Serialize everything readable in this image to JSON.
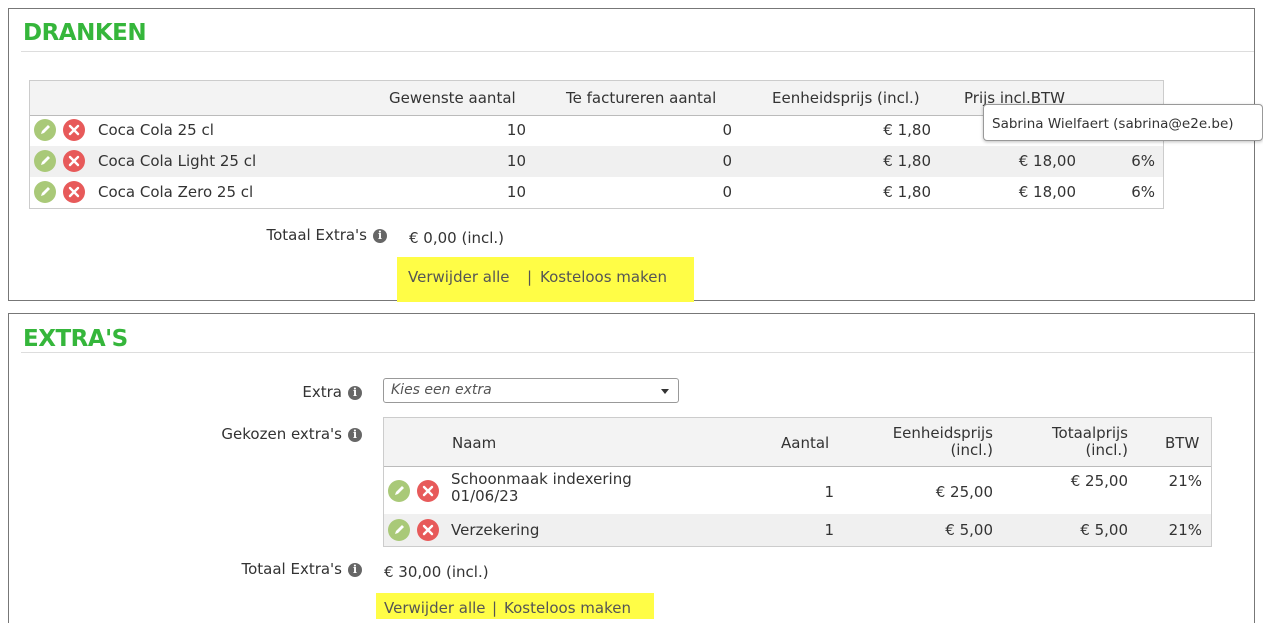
{
  "dranken": {
    "title": "DRANKEN",
    "headers": {
      "gewenst": "Gewenste aantal",
      "factureren": "Te factureren aantal",
      "eenheidsprijs": "Eenheidsprijs (incl.)",
      "prijs": "Prijs incl.BTW"
    },
    "rows": [
      {
        "name": "Coca Cola 25 cl",
        "gewenst": "10",
        "factureren": "0",
        "eenheidsprijs": "€ 1,80",
        "prijs": "",
        "btw": ""
      },
      {
        "name": "Coca Cola Light 25 cl",
        "gewenst": "10",
        "factureren": "0",
        "eenheidsprijs": "€ 1,80",
        "prijs": "€ 18,00",
        "btw": "6%"
      },
      {
        "name": "Coca Cola Zero 25 cl",
        "gewenst": "10",
        "factureren": "0",
        "eenheidsprijs": "€ 1,80",
        "prijs": "€ 18,00",
        "btw": "6%"
      }
    ],
    "tooltip": "Sabrina Wielfaert (sabrina@e2e.be)",
    "totaal_label": "Totaal Extra's",
    "totaal_value": "€ 0,00 (incl.)",
    "verwijder": "Verwijder alle",
    "separator": "|",
    "kosteloos": "Kosteloos maken"
  },
  "extras": {
    "title": "EXTRA'S",
    "extra_label": "Extra",
    "select_placeholder": "Kies een extra",
    "gekozen_label": "Gekozen extra's",
    "headers": {
      "naam": "Naam",
      "aantal": "Aantal",
      "eenheidsprijs_1": "Eenheidsprijs",
      "eenheidsprijs_2": "(incl.)",
      "totaalprijs_1": "Totaalprijs",
      "totaalprijs_2": "(incl.)",
      "btw": "BTW"
    },
    "rows": [
      {
        "name_1": "Schoonmaak indexering",
        "name_2": "01/06/23",
        "aantal": "1",
        "eenheidsprijs": "€ 25,00",
        "totaalprijs": "€ 25,00",
        "btw": "21%"
      },
      {
        "name_1": "Verzekering",
        "name_2": "",
        "aantal": "1",
        "eenheidsprijs": "€ 5,00",
        "totaalprijs": "€ 5,00",
        "btw": "21%"
      }
    ],
    "totaal_label": "Totaal Extra's",
    "totaal_value": "€ 30,00 (incl.)",
    "verwijder": "Verwijder alle",
    "separator": "|",
    "kosteloos": "Kosteloos maken"
  },
  "colors": {
    "title_green": "#35b63b",
    "edit_icon": "#a9c978",
    "delete_icon": "#e75a5a",
    "highlight": "#fffd46"
  },
  "icons": {
    "edit": "pencil-icon",
    "delete": "close-circle-icon",
    "info": "info-icon",
    "dropdown": "chevron-down-icon"
  }
}
